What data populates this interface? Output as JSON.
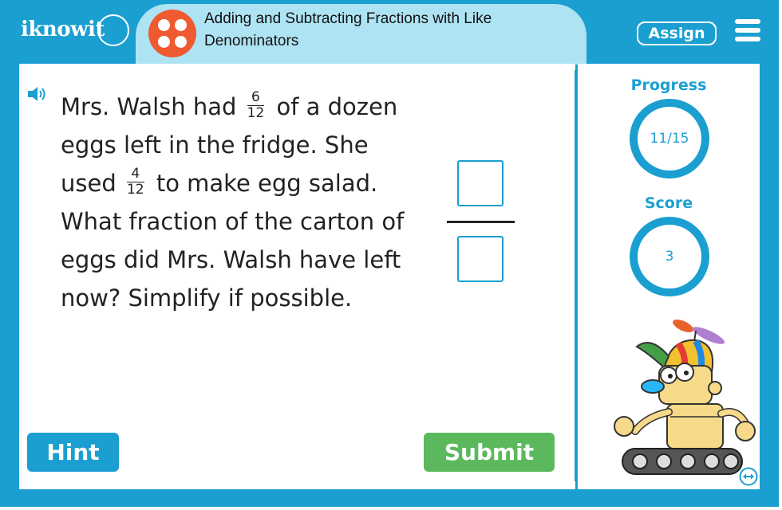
{
  "header": {
    "logo_text": "iknowit",
    "lesson_title": "Adding and Subtracting Fractions with Like Denominators",
    "assign_label": "Assign"
  },
  "question": {
    "part1": "Mrs. Walsh had",
    "frac1": {
      "num": "6",
      "den": "12"
    },
    "part2": "of a dozen eggs left in the fridge. She used",
    "frac2": {
      "num": "4",
      "den": "12"
    },
    "part3": "to make egg salad. What fraction of the carton of eggs did Mrs. Walsh have left now? Simplify if possible."
  },
  "answer": {
    "numerator": "",
    "denominator": ""
  },
  "buttons": {
    "hint_label": "Hint",
    "submit_label": "Submit"
  },
  "stats": {
    "progress_label": "Progress",
    "progress_value": "11/15",
    "score_label": "Score",
    "score_value": "3"
  },
  "colors": {
    "frame": "#1b9fd1",
    "title_pill": "#aee3f3",
    "lesson_icon": "#f05a30",
    "submit": "#5cb85c"
  },
  "icons": {
    "speaker": "speaker-icon",
    "menu": "hamburger-menu-icon",
    "lesson": "dice-icon",
    "swap": "swap-arrows-icon"
  }
}
